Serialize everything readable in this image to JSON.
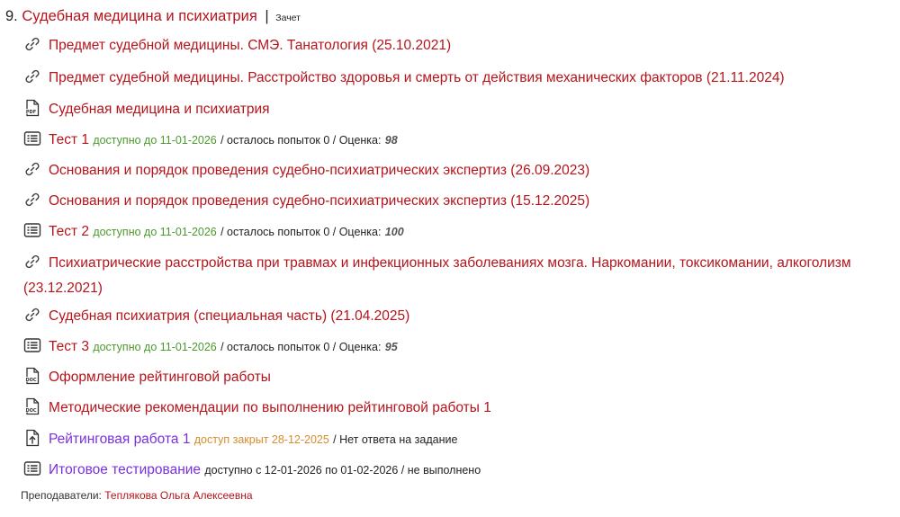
{
  "section": {
    "number": "9.",
    "title": "Судебная медицина и психиатрия",
    "separator": "|",
    "kind": "Зачет"
  },
  "items": [
    {
      "icon": "link-icon",
      "title": "Предмет судебной медицины. СМЭ. Танатология (25.10.2021)"
    },
    {
      "icon": "link-icon",
      "title": "Предмет судебной медицины. Расстройство здоровья и смерть от действия механических факторов (21.11.2024)"
    },
    {
      "icon": "pdf-file-icon",
      "title": "Судебная медицина и психиатрия"
    },
    {
      "icon": "quiz-icon",
      "title": "Тест 1",
      "availability": "доступно до 11-01-2026",
      "attempts": "/ осталось попыток 0 / Оценка:",
      "grade": "98"
    },
    {
      "icon": "link-icon",
      "title": "Основания и порядок проведения судебно-психиатрических экспертиз (26.09.2023)"
    },
    {
      "icon": "link-icon",
      "title": "Основания и порядок проведения судебно-психиатрических экспертиз (15.12.2025)"
    },
    {
      "icon": "quiz-icon",
      "title": "Тест 2",
      "availability": "доступно до 11-01-2026",
      "attempts": "/ осталось попыток 0 / Оценка:",
      "grade": "100"
    },
    {
      "icon": "link-icon",
      "title": "Психиатрические расстройства при травмах и инфекционных заболеваниях мозга. Наркомании, токсикомании, алкоголизм (23.12.2021)"
    },
    {
      "icon": "link-icon",
      "title": "Судебная психиатрия (специальная часть) (21.04.2025)"
    },
    {
      "icon": "quiz-icon",
      "title": "Тест 3",
      "availability": "доступно до 11-01-2026",
      "attempts": "/ осталось попыток 0 / Оценка:",
      "grade": "95"
    },
    {
      "icon": "doc-file-icon",
      "title": "Оформление рейтинговой работы"
    },
    {
      "icon": "doc-file-icon",
      "title": "Методические рекомендации по выполнению рейтинговой работы 1"
    },
    {
      "icon": "assignment-upload-icon",
      "title": "Рейтинговая работа 1",
      "availability": "доступ закрыт 28-12-2025",
      "status": "/ Нет ответа на задание"
    },
    {
      "icon": "quiz-icon",
      "title": "Итоговое тестирование",
      "status": "доступно с 12-01-2026 по 01-02-2026 / не выполнено"
    }
  ],
  "teachers": {
    "label": "Преподаватели:",
    "name": "Теплякова Ольга Алексеевна"
  },
  "colors": {
    "link": "#b5141b",
    "link_purple": "#7a2fe0",
    "available_green": "#4b9a2e",
    "closed_orange": "#d78c2b"
  }
}
